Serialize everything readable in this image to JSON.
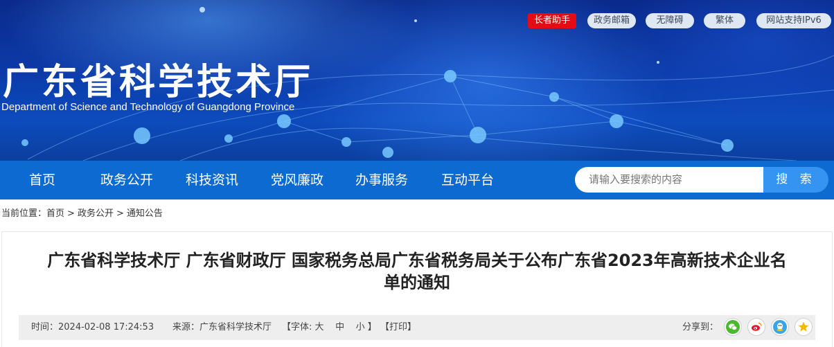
{
  "header": {
    "title": "广东省科学技术厅",
    "subtitle": "Department of Science and Technology of Guangdong Province",
    "top_links": [
      "长者助手",
      "政务邮箱",
      "无障碍",
      "繁体",
      "网站支持IPv6"
    ]
  },
  "nav": {
    "items": [
      "首页",
      "政务公开",
      "科技资讯",
      "党风廉政",
      "办事服务",
      "互动平台"
    ],
    "search_placeholder": "请输入要搜索的内容",
    "search_button": "搜 索"
  },
  "breadcrumb": {
    "prefix": "当前位置：",
    "items": [
      "首页",
      "政务公开",
      "通知公告"
    ],
    "separator": ">"
  },
  "article": {
    "title_line1": "广东省科学技术厅 广东省财政厅 国家税务总局广东省税务局关于公布广东省2023年高新技术企业名",
    "title_line2": "单的通知",
    "time_label": "时间：",
    "time": "2024-02-08 17:24:53",
    "source_label": "来源：",
    "source": "广东省科学技术厅",
    "font_label": "【字体:",
    "font_large": "大",
    "font_medium": "中",
    "font_small": "小",
    "font_close": "】",
    "print": "【打印】",
    "share_label": "分享到：",
    "share_icons": [
      "wechat-icon",
      "weibo-icon",
      "qq-icon",
      "qzone-icon"
    ]
  },
  "colors": {
    "nav_bg": "#0d6ad1",
    "search_button": "#3594f2",
    "elder_badge": "#e30b14",
    "wechat": "#4bb82f",
    "weibo": "#e6162d",
    "qq": "#3aa5e6",
    "qzone": "#f5b800"
  }
}
